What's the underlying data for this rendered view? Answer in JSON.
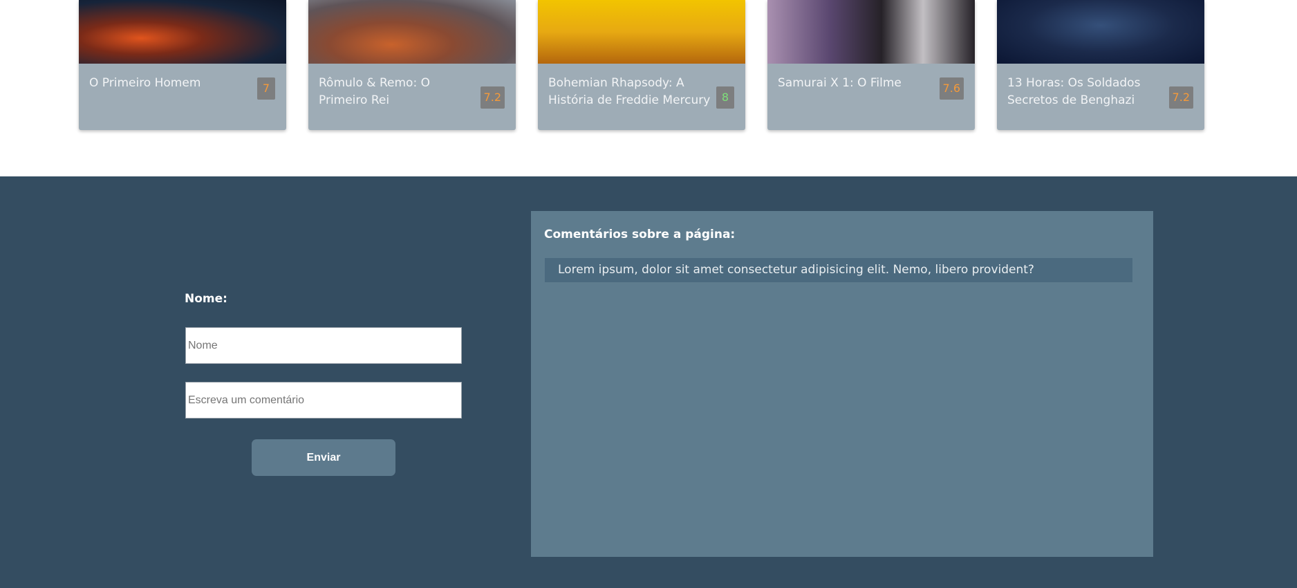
{
  "movies": [
    {
      "title": "O Primeiro Homem",
      "rating": "7",
      "poster_icon": "movie-poster-image"
    },
    {
      "title": "Rômulo & Remo: O Primeiro Rei",
      "rating": "7.2",
      "poster_icon": "movie-poster-image"
    },
    {
      "title": "Bohemian Rhapsody: A História de Freddie Mercury",
      "rating": "8",
      "poster_icon": "movie-poster-image"
    },
    {
      "title": "Samurai X 1: O Filme",
      "rating": "7.6",
      "poster_icon": "movie-poster-image"
    },
    {
      "title": "13 Horas: Os Soldados Secretos de Benghazi",
      "rating": "7.2",
      "poster_icon": "movie-poster-image"
    }
  ],
  "form": {
    "name_label": "Nome:",
    "name_placeholder": "Nome",
    "comment_placeholder": "Escreva um comentário",
    "submit_label": "Enviar"
  },
  "comments": {
    "title": "Comentários sobre a página:",
    "items": [
      "Lorem ipsum, dolor sit amet consectetur adipisicing elit. Nemo, libero provident?"
    ]
  },
  "colors": {
    "section_background": "#344d61",
    "panel_background": "#5e7c8e",
    "card_background": "#9eacb6",
    "rating_orange": "#f59a3a",
    "rating_green": "#7ee07a"
  }
}
